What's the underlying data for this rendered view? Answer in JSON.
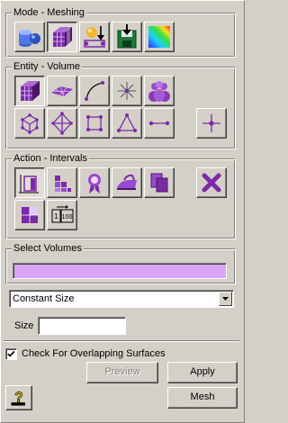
{
  "mode": {
    "label": "Mode - Meshing",
    "buttons": [
      {
        "icon": "geometry-mode-icon",
        "pressed": false
      },
      {
        "icon": "meshing-mode-icon",
        "pressed": true
      },
      {
        "icon": "boundary-conditions-icon",
        "pressed": false
      },
      {
        "icon": "export-mesh-icon",
        "pressed": false
      },
      {
        "icon": "analysis-contour-icon",
        "pressed": false
      }
    ]
  },
  "entity": {
    "label": "Entity - Volume",
    "buttons": [
      {
        "icon": "volume-icon",
        "pressed": true
      },
      {
        "icon": "surface-icon",
        "pressed": false
      },
      {
        "icon": "curve-icon",
        "pressed": false
      },
      {
        "icon": "vertex-icon",
        "pressed": false
      },
      {
        "icon": "group-icon",
        "pressed": false
      },
      {
        "icon": "hex-element-icon",
        "pressed": false
      },
      {
        "icon": "tet-element-icon",
        "pressed": false
      },
      {
        "icon": "quad-element-icon",
        "pressed": false
      },
      {
        "icon": "tri-element-icon",
        "pressed": false
      },
      {
        "icon": "edge-element-icon",
        "pressed": false
      },
      {
        "icon": "node-icon",
        "pressed": false
      }
    ]
  },
  "action": {
    "label": "Action - Intervals",
    "buttons": [
      {
        "icon": "intervals-icon",
        "pressed": true
      },
      {
        "icon": "scheme-icon",
        "pressed": false
      },
      {
        "icon": "quality-ribbon-icon",
        "pressed": false
      },
      {
        "icon": "smooth-iron-icon",
        "pressed": false
      },
      {
        "icon": "copy-mesh-icon",
        "pressed": false
      },
      {
        "icon": "delete-mesh-icon",
        "pressed": false
      },
      {
        "icon": "refine-icon",
        "pressed": false
      },
      {
        "icon": "renumber-icon",
        "pressed": false
      }
    ]
  },
  "form": {
    "select_label": "Select Volumes",
    "select_value": "",
    "sizing_options": [
      "Constant Size"
    ],
    "sizing_selected": "Constant Size",
    "size_label": "Size",
    "size_value": "",
    "overlap_label": "Check For Overlapping Surfaces",
    "overlap_checked": true
  },
  "footer": {
    "preview_label": "Preview",
    "apply_label": "Apply",
    "mesh_label": "Mesh",
    "help_icon": "help-icon"
  },
  "colors": {
    "panel": "#d4d0c8",
    "accent_purple": "#6a1b8c",
    "select_field": "#d9a6f5"
  }
}
